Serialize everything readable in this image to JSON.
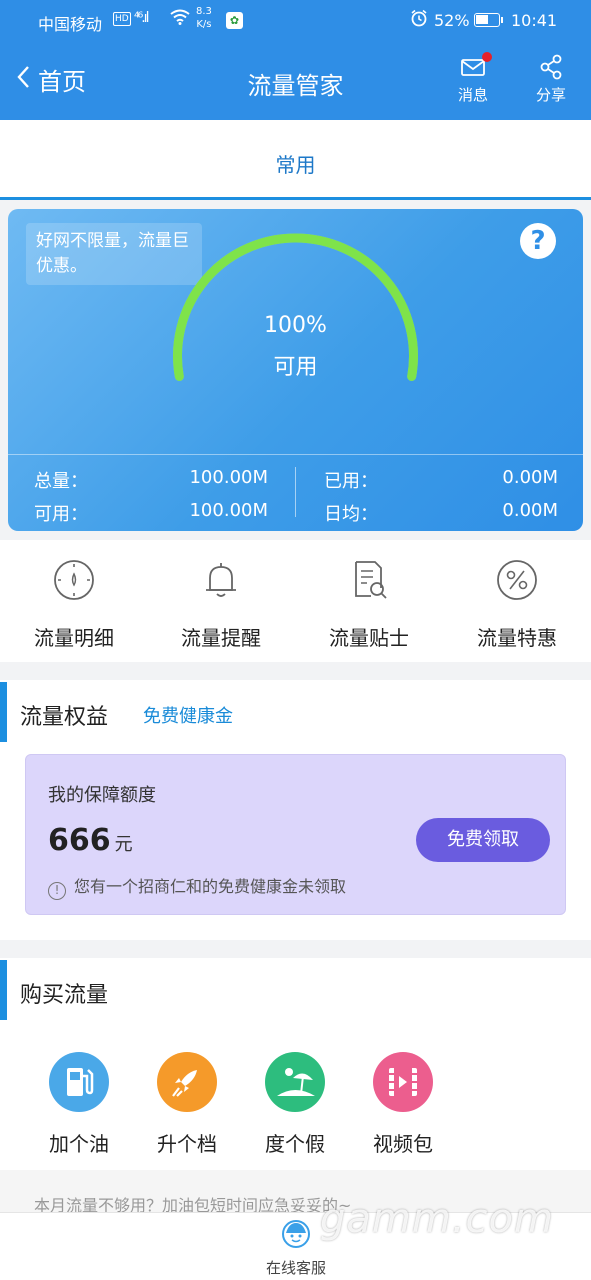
{
  "status_bar": {
    "carrier": "中国移动",
    "hd": "HD",
    "signal": "⁴⁶.ıl",
    "speed_top": "8.3",
    "speed_bottom": "K/s",
    "battery": "52%",
    "time": "10:41"
  },
  "header": {
    "back_label": "首页",
    "title": "流量管家",
    "messages_label": "消息",
    "share_label": "分享",
    "color": "#2f8ee6"
  },
  "tabs": {
    "active": "常用"
  },
  "gauge": {
    "promo": "好网不限量，流量巨优惠。",
    "help": "?",
    "percent_text": "100%",
    "percent_value": 100,
    "status": "可用",
    "arc_color": "#7fe34a",
    "total_label": "总量：",
    "total_value": "100.00M",
    "available_label": "可用：",
    "available_value": "100.00M",
    "used_label": "已用：",
    "used_value": "0.00M",
    "daily_label": "日均：",
    "daily_value": "0.00M"
  },
  "tools": [
    {
      "label": "流量明细",
      "icon": "compass-icon"
    },
    {
      "label": "流量提醒",
      "icon": "bell-icon"
    },
    {
      "label": "流量贴士",
      "icon": "document-search-icon"
    },
    {
      "label": "流量特惠",
      "icon": "percent-icon"
    }
  ],
  "benefits": {
    "title": "流量权益",
    "subtitle": "免费健康金",
    "card_title": "我的保障额度",
    "amount": "666",
    "unit": "元",
    "button": "免费领取",
    "note": "您有一个招商仁和的免费健康金未领取",
    "button_color": "#6a5cdf"
  },
  "buy": {
    "title": "购买流量",
    "packages": [
      {
        "label": "加个油",
        "icon": "fuel-icon",
        "color": "#4aa8e8"
      },
      {
        "label": "升个档",
        "icon": "rocket-icon",
        "color": "#f59a2a"
      },
      {
        "label": "度个假",
        "icon": "beach-icon",
        "color": "#2dbd7e"
      },
      {
        "label": "视频包",
        "icon": "film-icon",
        "color": "#ec5e8e"
      }
    ],
    "hint": "本月流量不够用？加油包短时间应急妥妥的~"
  },
  "footer": {
    "service_label": "在线客服"
  },
  "watermark": "gamm.com"
}
